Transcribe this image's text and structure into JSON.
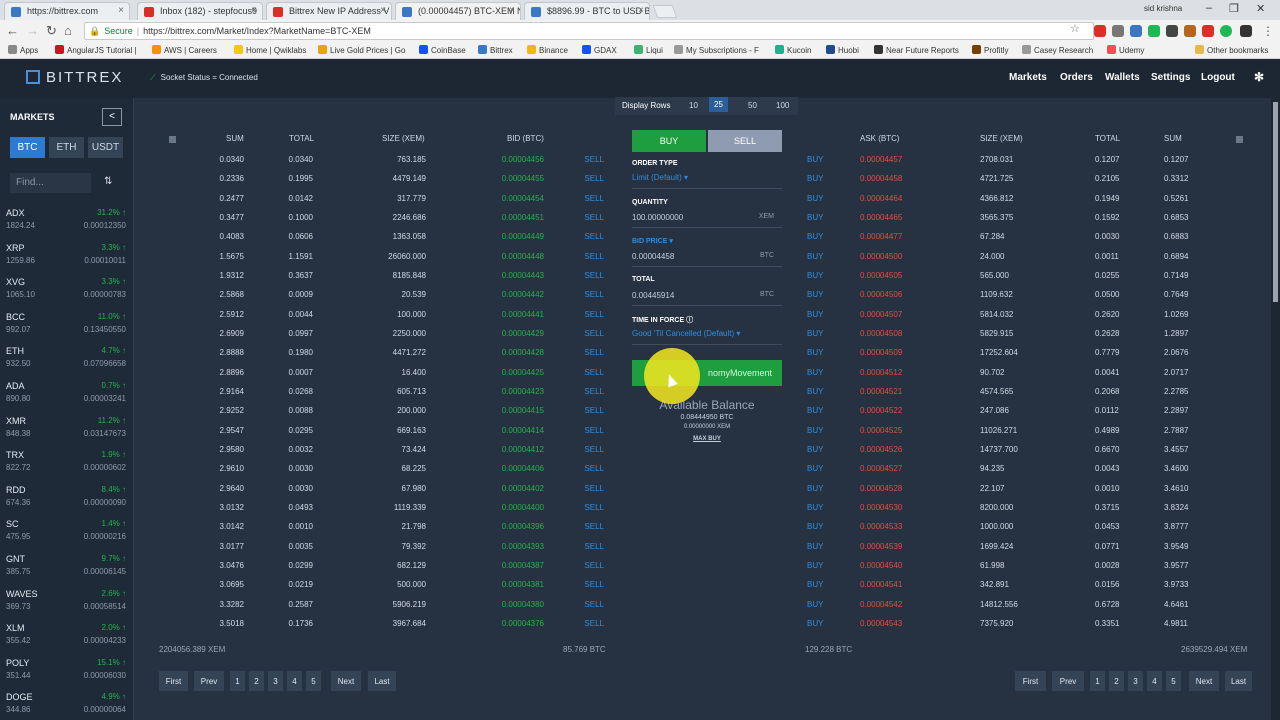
{
  "browser": {
    "tabs": [
      {
        "label": "https://bittrex.com",
        "color": "#3b78c4"
      },
      {
        "label": "Inbox (182) - stepfocus9",
        "color": "#d93025"
      },
      {
        "label": "Bittrex New IP Address V",
        "color": "#d93025"
      },
      {
        "label": "(0.00004457) BTC-XEM N",
        "color": "#3b78c4",
        "active": true
      },
      {
        "label": "$8896.99 - BTC to USD B",
        "color": "#3b78c4"
      }
    ],
    "user": "sid krishna",
    "secure_label": "Secure",
    "url": "https://bittrex.com/Market/Index?MarketName=BTC-XEM",
    "bookmarks": [
      {
        "label": "Apps",
        "color": "#888888"
      },
      {
        "label": "AngularJS Tutorial |",
        "color": "#c5171f"
      },
      {
        "label": "AWS | Careers",
        "color": "#f29111"
      },
      {
        "label": "Home | Qwiklabs",
        "color": "#f5c518"
      },
      {
        "label": "Live Gold Prices | Go",
        "color": "#e8a317"
      },
      {
        "label": "CoinBase",
        "color": "#1652f0"
      },
      {
        "label": "Bittrex",
        "color": "#3b78c4"
      },
      {
        "label": "Binance",
        "color": "#f0b90b"
      },
      {
        "label": "GDAX",
        "color": "#1652f0"
      },
      {
        "label": "Liqui",
        "color": "#3cb371"
      },
      {
        "label": "My Subscriptions - F",
        "color": "#999999"
      },
      {
        "label": "Kucoin",
        "color": "#24ae8f"
      },
      {
        "label": "Huobi",
        "color": "#1d4d8f"
      },
      {
        "label": "Near Future Reports",
        "color": "#333333"
      },
      {
        "label": "Profitly",
        "color": "#7a3e00"
      },
      {
        "label": "Casey Research",
        "color": "#999999"
      },
      {
        "label": "Udemy",
        "color": "#ec5252"
      },
      {
        "label": "Other bookmarks",
        "color": "#e8b84a"
      }
    ]
  },
  "header": {
    "logo": "BITTREX",
    "socket_status": "Socket Status = Connected",
    "nav": [
      "Markets",
      "Orders",
      "Wallets",
      "Settings",
      "Logout"
    ]
  },
  "sidebar": {
    "title": "MARKETS",
    "collapse": "<",
    "tabs": [
      "BTC",
      "ETH",
      "USDT"
    ],
    "find_placeholder": "Find...",
    "sort": "⇅",
    "markets": [
      {
        "sym": "ADX",
        "chg": "31.2% ↑",
        "vol": "1824.24",
        "px": "0.00012350"
      },
      {
        "sym": "XRP",
        "chg": "3.3% ↑",
        "vol": "1259.86",
        "px": "0.00010011"
      },
      {
        "sym": "XVG",
        "chg": "3.3% ↑",
        "vol": "1065.10",
        "px": "0.00000783"
      },
      {
        "sym": "BCC",
        "chg": "11.0% ↑",
        "vol": "992.07",
        "px": "0.13450550"
      },
      {
        "sym": "ETH",
        "chg": "4.7% ↑",
        "vol": "932.50",
        "px": "0.07096658"
      },
      {
        "sym": "ADA",
        "chg": "0.7% ↑",
        "vol": "890.80",
        "px": "0.00003241"
      },
      {
        "sym": "XMR",
        "chg": "11.2% ↑",
        "vol": "848.38",
        "px": "0.03147673"
      },
      {
        "sym": "TRX",
        "chg": "1.9% ↑",
        "vol": "822.72",
        "px": "0.00000602"
      },
      {
        "sym": "RDD",
        "chg": "8.4% ↑",
        "vol": "674.36",
        "px": "0.00000090"
      },
      {
        "sym": "SC",
        "chg": "1.4% ↑",
        "vol": "475.95",
        "px": "0.00000216"
      },
      {
        "sym": "GNT",
        "chg": "9.7% ↑",
        "vol": "385.75",
        "px": "0.00006145"
      },
      {
        "sym": "WAVES",
        "chg": "2.6% ↑",
        "vol": "369.73",
        "px": "0.00058514"
      },
      {
        "sym": "XLM",
        "chg": "2.0% ↑",
        "vol": "355.42",
        "px": "0.00004233"
      },
      {
        "sym": "POLY",
        "chg": "15.1% ↑",
        "vol": "351.44",
        "px": "0.00006030"
      },
      {
        "sym": "DOGE",
        "chg": "4.9% ↑",
        "vol": "344.86",
        "px": "0.00000064"
      }
    ]
  },
  "display_rows": {
    "label": "Display Rows",
    "options": [
      "10",
      "25",
      "50",
      "100"
    ],
    "selected": "25"
  },
  "bids": {
    "headers": [
      "SUM",
      "TOTAL",
      "SIZE (XEM)",
      "BID (BTC)"
    ],
    "action": "SELL",
    "rows": [
      [
        "0.0340",
        "0.0340",
        "763.185",
        "0.00004456"
      ],
      [
        "0.2336",
        "0.1995",
        "4479.149",
        "0.00004455"
      ],
      [
        "0.2477",
        "0.0142",
        "317.779",
        "0.00004454"
      ],
      [
        "0.3477",
        "0.1000",
        "2246.686",
        "0.00004451"
      ],
      [
        "0.4083",
        "0.0606",
        "1363.058",
        "0.00004449"
      ],
      [
        "1.5675",
        "1.1591",
        "26060.000",
        "0.00004448"
      ],
      [
        "1.9312",
        "0.3637",
        "8185.848",
        "0.00004443"
      ],
      [
        "2.5868",
        "0.0009",
        "20.539",
        "0.00004442"
      ],
      [
        "2.5912",
        "0.0044",
        "100.000",
        "0.00004441"
      ],
      [
        "2.6909",
        "0.0997",
        "2250.000",
        "0.00004429"
      ],
      [
        "2.8888",
        "0.1980",
        "4471.272",
        "0.00004428"
      ],
      [
        "2.8896",
        "0.0007",
        "16.400",
        "0.00004425"
      ],
      [
        "2.9164",
        "0.0268",
        "605.713",
        "0.00004423"
      ],
      [
        "2.9252",
        "0.0088",
        "200.000",
        "0.00004415"
      ],
      [
        "2.9547",
        "0.0295",
        "669.163",
        "0.00004414"
      ],
      [
        "2.9580",
        "0.0032",
        "73.424",
        "0.00004412"
      ],
      [
        "2.9610",
        "0.0030",
        "68.225",
        "0.00004406"
      ],
      [
        "2.9640",
        "0.0030",
        "67.980",
        "0.00004402"
      ],
      [
        "3.0132",
        "0.0493",
        "1119.339",
        "0.00004400"
      ],
      [
        "3.0142",
        "0.0010",
        "21.798",
        "0.00004396"
      ],
      [
        "3.0177",
        "0.0035",
        "79.392",
        "0.00004393"
      ],
      [
        "3.0476",
        "0.0299",
        "682.129",
        "0.00004387"
      ],
      [
        "3.0695",
        "0.0219",
        "500.000",
        "0.00004381"
      ],
      [
        "3.3282",
        "0.2587",
        "5906.219",
        "0.00004380"
      ],
      [
        "3.5018",
        "0.1736",
        "3967.684",
        "0.00004376"
      ]
    ],
    "footer_left": "2204056.389 XEM",
    "footer_right": "85.769 BTC"
  },
  "asks": {
    "headers": [
      "ASK (BTC)",
      "SIZE (XEM)",
      "TOTAL",
      "SUM"
    ],
    "action": "BUY",
    "rows": [
      [
        "0.00004457",
        "2708.031",
        "0.1207",
        "0.1207"
      ],
      [
        "0.00004458",
        "4721.725",
        "0.2105",
        "0.3312"
      ],
      [
        "0.00004464",
        "4366.812",
        "0.1949",
        "0.5261"
      ],
      [
        "0.00004465",
        "3565.375",
        "0.1592",
        "0.6853"
      ],
      [
        "0.00004477",
        "67.284",
        "0.0030",
        "0.6883"
      ],
      [
        "0.00004500",
        "24.000",
        "0.0011",
        "0.6894"
      ],
      [
        "0.00004505",
        "565.000",
        "0.0255",
        "0.7149"
      ],
      [
        "0.00004506",
        "1109.632",
        "0.0500",
        "0.7649"
      ],
      [
        "0.00004507",
        "5814.032",
        "0.2620",
        "1.0269"
      ],
      [
        "0.00004508",
        "5829.915",
        "0.2628",
        "1.2897"
      ],
      [
        "0.00004509",
        "17252.604",
        "0.7779",
        "2.0676"
      ],
      [
        "0.00004512",
        "90.702",
        "0.0041",
        "2.0717"
      ],
      [
        "0.00004521",
        "4574.565",
        "0.2068",
        "2.2785"
      ],
      [
        "0.00004522",
        "247.086",
        "0.0112",
        "2.2897"
      ],
      [
        "0.00004525",
        "11026.271",
        "0.4989",
        "2.7887"
      ],
      [
        "0.00004526",
        "14737.700",
        "0.6670",
        "3.4557"
      ],
      [
        "0.00004527",
        "94.235",
        "0.0043",
        "3.4600"
      ],
      [
        "0.00004528",
        "22.107",
        "0.0010",
        "3.4610"
      ],
      [
        "0.00004530",
        "8200.000",
        "0.3715",
        "3.8324"
      ],
      [
        "0.00004533",
        "1000.000",
        "0.0453",
        "3.8777"
      ],
      [
        "0.00004539",
        "1699.424",
        "0.0771",
        "3.9549"
      ],
      [
        "0.00004540",
        "61.998",
        "0.0028",
        "3.9577"
      ],
      [
        "0.00004541",
        "342.891",
        "0.0156",
        "3.9733"
      ],
      [
        "0.00004542",
        "14812.556",
        "0.6728",
        "4.6461"
      ],
      [
        "0.00004543",
        "7375.920",
        "0.3351",
        "4.9811"
      ]
    ],
    "footer_left": "129.228 BTC",
    "footer_right": "2639529.494 XEM"
  },
  "pager": [
    "First",
    "Prev",
    "1",
    "2",
    "3",
    "4",
    "5",
    "Next",
    "Last"
  ],
  "order": {
    "buy_label": "BUY",
    "sell_label": "SELL",
    "order_type_label": "ORDER TYPE",
    "order_type_value": "Limit (Default)",
    "quantity_label": "QUANTITY",
    "quantity_value": "100.00000000",
    "quantity_unit": "XEM",
    "bid_price_label": "BID PRICE",
    "bid_price_value": "0.00004458",
    "bid_price_unit": "BTC",
    "total_label": "TOTAL",
    "total_value": "0.00445914",
    "total_unit": "BTC",
    "tif_label": "TIME IN FORCE",
    "tif_value": "Good 'Til Cancelled (Default)",
    "submit_label": "nomyMovement",
    "balance_title": "Available Balance",
    "balance_btc": "0.08444950 BTC",
    "balance_xem": "0.00000000 XEM",
    "max_buy": "MAX BUY"
  }
}
